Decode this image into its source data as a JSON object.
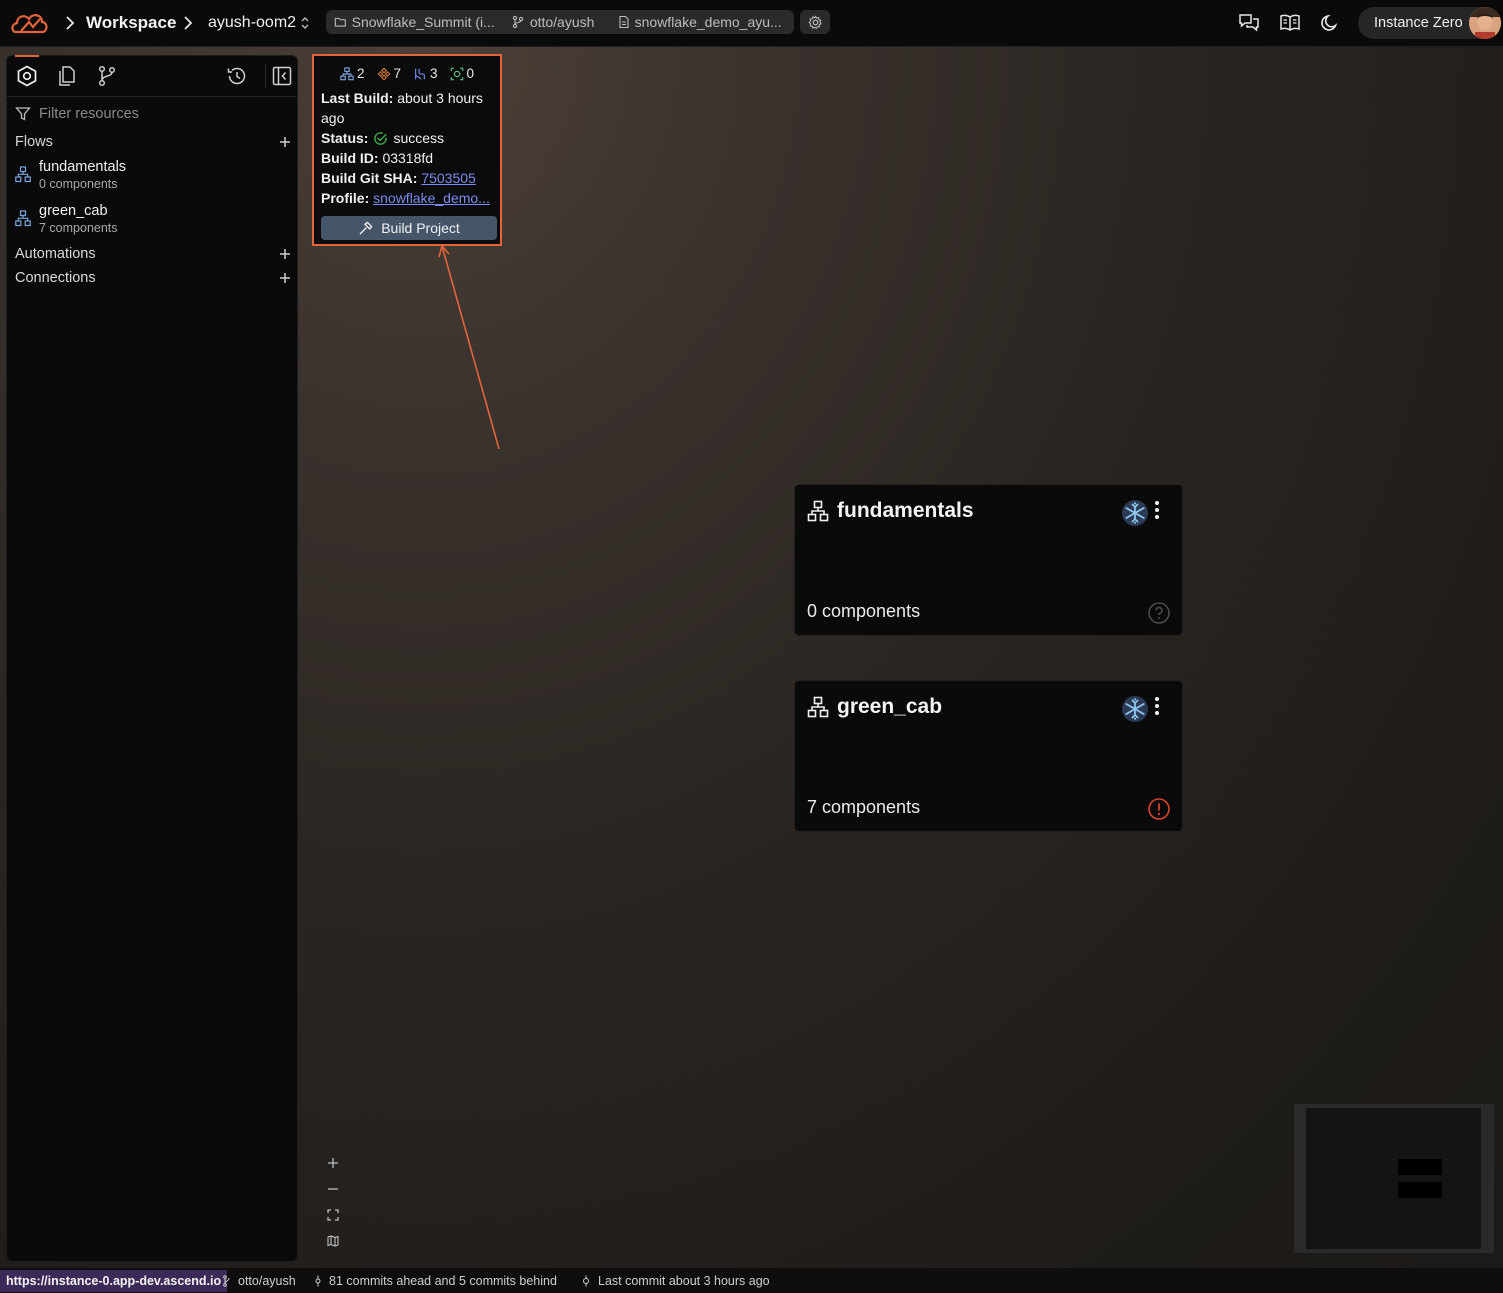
{
  "topbar": {
    "breadcrumb_workspace": "Workspace",
    "breadcrumb_workspace_name": "ayush-oom2",
    "project_pill": "Snowflake_Summit (i...",
    "branch_pill": "otto/ayush",
    "profile_pill": "snowflake_demo_ayu...",
    "instance_label": "Instance Zero"
  },
  "sidebar": {
    "filter_placeholder": "Filter resources",
    "sections": {
      "flows": "Flows",
      "automations": "Automations",
      "connections": "Connections"
    },
    "flows": [
      {
        "name": "fundamentals",
        "sub": "0 components"
      },
      {
        "name": "green_cab",
        "sub": "7 components"
      }
    ]
  },
  "popover": {
    "stat_flows": "2",
    "stat_components": "7",
    "stat_connections": "3",
    "stat_automations": "0",
    "last_build_label": "Last Build:",
    "last_build_value": "about 3 hours",
    "last_build_value_2": "ago",
    "status_label": "Status:",
    "status_value": "success",
    "build_id_label": "Build ID:",
    "build_id_value": "03318fd",
    "git_sha_label": "Build Git SHA:",
    "git_sha_value": "7503505",
    "profile_label": "Profile:",
    "profile_value": "snowflake_demo...",
    "build_button": "Build Project"
  },
  "cards": [
    {
      "title": "fundamentals",
      "count": "0 components",
      "status": "unknown"
    },
    {
      "title": "green_cab",
      "count": "7 components",
      "status": "error"
    }
  ],
  "statusbar": {
    "url": "https://instance-0.app-dev.ascend.io",
    "branch": "otto/ayush",
    "commits": "81 commits ahead and 5 commits behind",
    "last_commit": "Last commit about 3 hours ago"
  },
  "colors": {
    "accent_orange": "#e2643a",
    "link_blue": "#7b8cf0",
    "success_green": "#3fb950",
    "error_red": "#d9442b",
    "flow_icon_blue": "#7aa7e0"
  }
}
